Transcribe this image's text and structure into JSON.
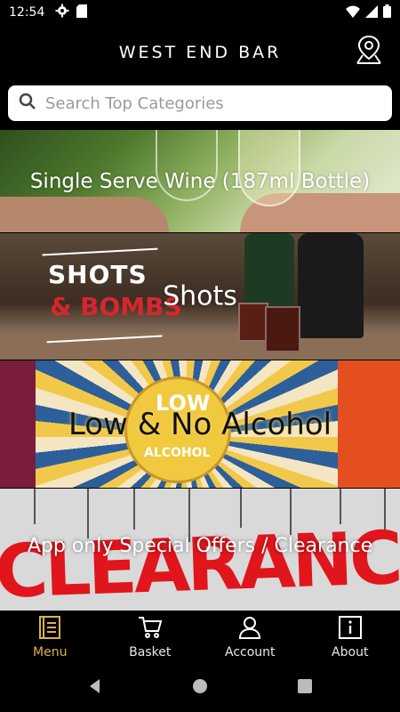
{
  "status_bar": {
    "time": "12:54",
    "left_icons": [
      "gear-icon",
      "sd-card-icon"
    ],
    "right_icons": [
      "wifi-icon",
      "signal-icon",
      "battery-icon"
    ]
  },
  "header": {
    "title": "WEST END BAR",
    "location_icon": "location-pin-icon"
  },
  "search": {
    "placeholder": "Search Top Categories",
    "icon": "search-icon"
  },
  "categories": [
    {
      "label": "Single Serve Wine (187ml Bottle)"
    },
    {
      "label": "Shots",
      "sign_top": "SHOTS",
      "sign_bottom": "& BOMBS"
    },
    {
      "label": "Low & No Alcohol",
      "badge_top": "LOW",
      "badge_bottom": "ALCOHOL"
    },
    {
      "label": "App only Special Offers / Clearance",
      "banner": "CLEARANCE"
    }
  ],
  "bottom_nav": {
    "items": [
      {
        "label": "Menu",
        "icon": "menu-book-icon",
        "active": true
      },
      {
        "label": "Basket",
        "icon": "cart-icon",
        "active": false
      },
      {
        "label": "Account",
        "icon": "user-icon",
        "active": false
      },
      {
        "label": "About",
        "icon": "info-icon",
        "active": false
      }
    ],
    "active_color": "#d8b24a"
  },
  "system_nav": {
    "items": [
      "back-icon",
      "home-icon",
      "recents-icon"
    ]
  }
}
